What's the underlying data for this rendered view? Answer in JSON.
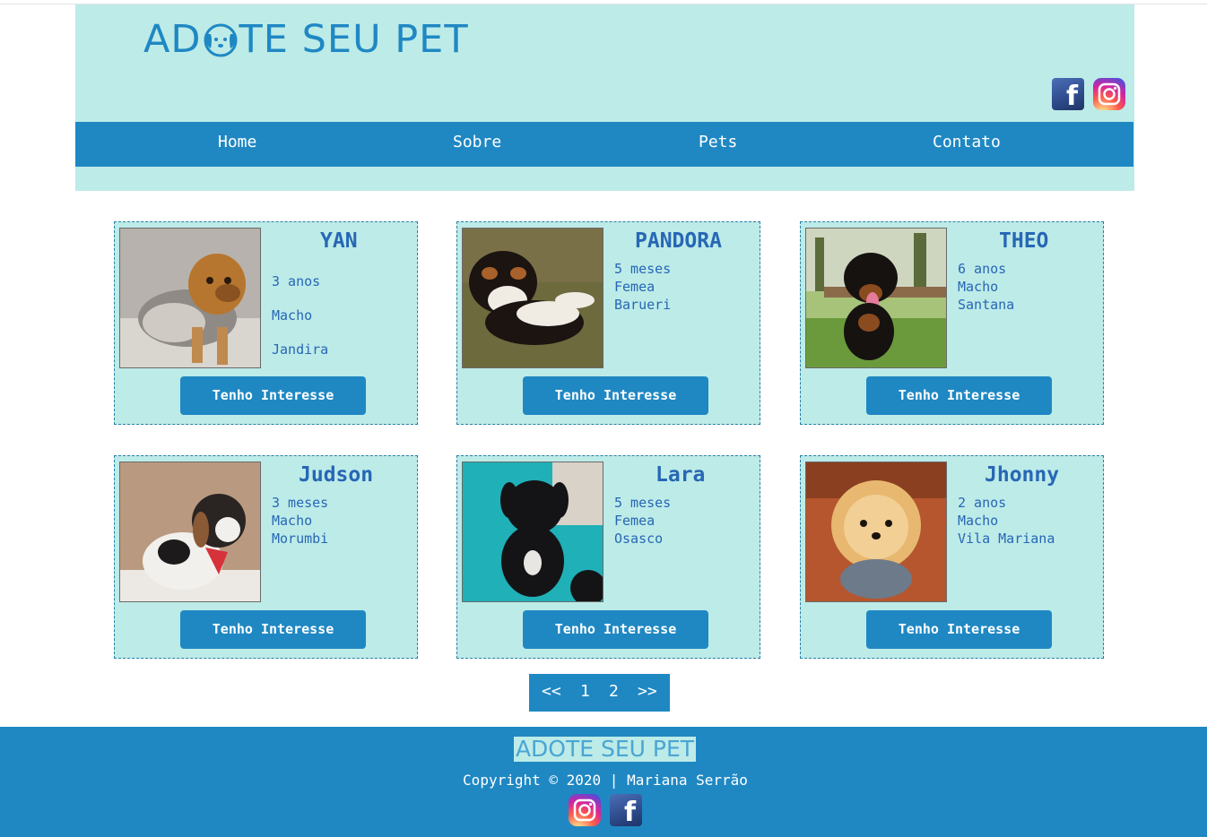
{
  "header": {
    "logo_text_left": "AD",
    "logo_text_right": "TE SEU PET",
    "social": [
      "facebook-icon",
      "instagram-icon"
    ]
  },
  "nav": {
    "items": [
      {
        "label": "Home"
      },
      {
        "label": "Sobre"
      },
      {
        "label": "Pets"
      },
      {
        "label": "Contato"
      }
    ]
  },
  "pets": [
    {
      "name": "YAN",
      "info": [
        "3 anos",
        "Macho",
        "Jandira"
      ],
      "button": "Tenho Interesse"
    },
    {
      "name": "PANDORA",
      "info": [
        "5 meses",
        "Femea",
        "Barueri"
      ],
      "button": "Tenho Interesse"
    },
    {
      "name": "THEO",
      "info": [
        "6 anos",
        "Macho",
        "Santana"
      ],
      "button": "Tenho Interesse"
    },
    {
      "name": "Judson",
      "info": [
        "3 meses",
        "Macho",
        "Morumbi"
      ],
      "button": "Tenho Interesse"
    },
    {
      "name": "Lara",
      "info": [
        "5 meses",
        "Femea",
        "Osasco"
      ],
      "button": "Tenho Interesse"
    },
    {
      "name": "Jhonny",
      "info": [
        "2 anos",
        "Macho",
        "Vila Mariana"
      ],
      "button": "Tenho Interesse"
    }
  ],
  "pagination": {
    "prev": "<<",
    "pages": [
      "1",
      "2"
    ],
    "next": ">>"
  },
  "footer": {
    "logo_text": "ADOTE SEU PET",
    "copyright": "Copyright © 2020 | Mariana Serrão"
  },
  "colors": {
    "primary": "#1f88c3",
    "mint": "#bdebe8",
    "text": "#2767b5"
  }
}
